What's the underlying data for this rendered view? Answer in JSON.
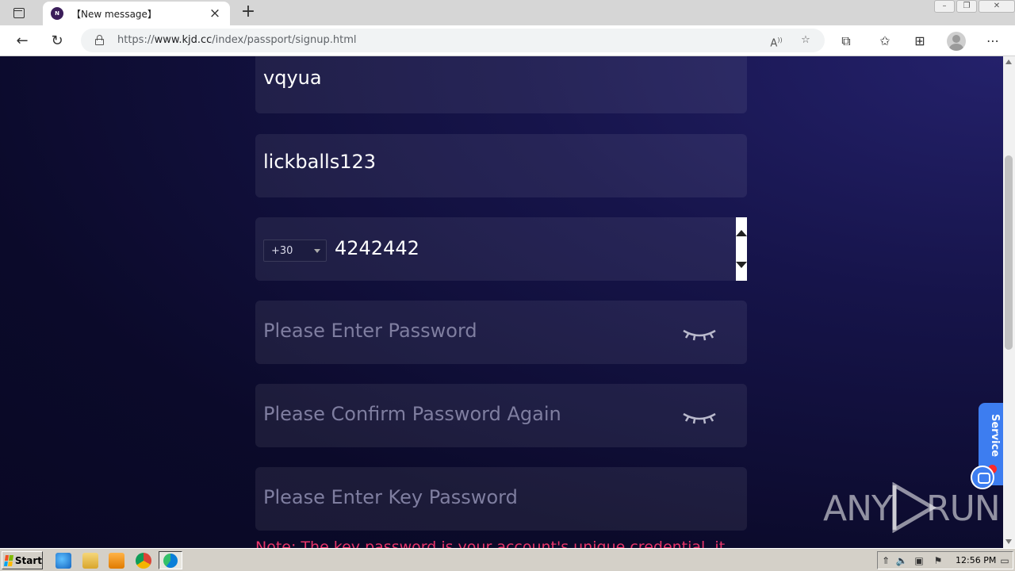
{
  "browser": {
    "tab_title": "【New message】",
    "favicon_letter": "N",
    "url_prefix": "https://",
    "url_host": "www.kjd.cc",
    "url_path": "/index/passport/signup.html"
  },
  "form": {
    "username_value": "vqyua",
    "invite_value": "lickballs123",
    "country_code": "+30",
    "phone_value": "4242442",
    "password_placeholder": "Please Enter Password",
    "confirm_placeholder": "Please Confirm Password Again",
    "key_password_placeholder": "Please Enter Key Password",
    "note_text": "Note: The key password is your account's unique credential, it"
  },
  "service": {
    "label": "Service"
  },
  "watermark": {
    "left": "ANY",
    "right": "RUN"
  },
  "taskbar": {
    "start_label": "Start",
    "clock": "12:56 PM"
  },
  "colors": {
    "accent_pink": "#e8356a",
    "service_blue": "#3d7df0",
    "page_bg": "#0b0a2a"
  }
}
